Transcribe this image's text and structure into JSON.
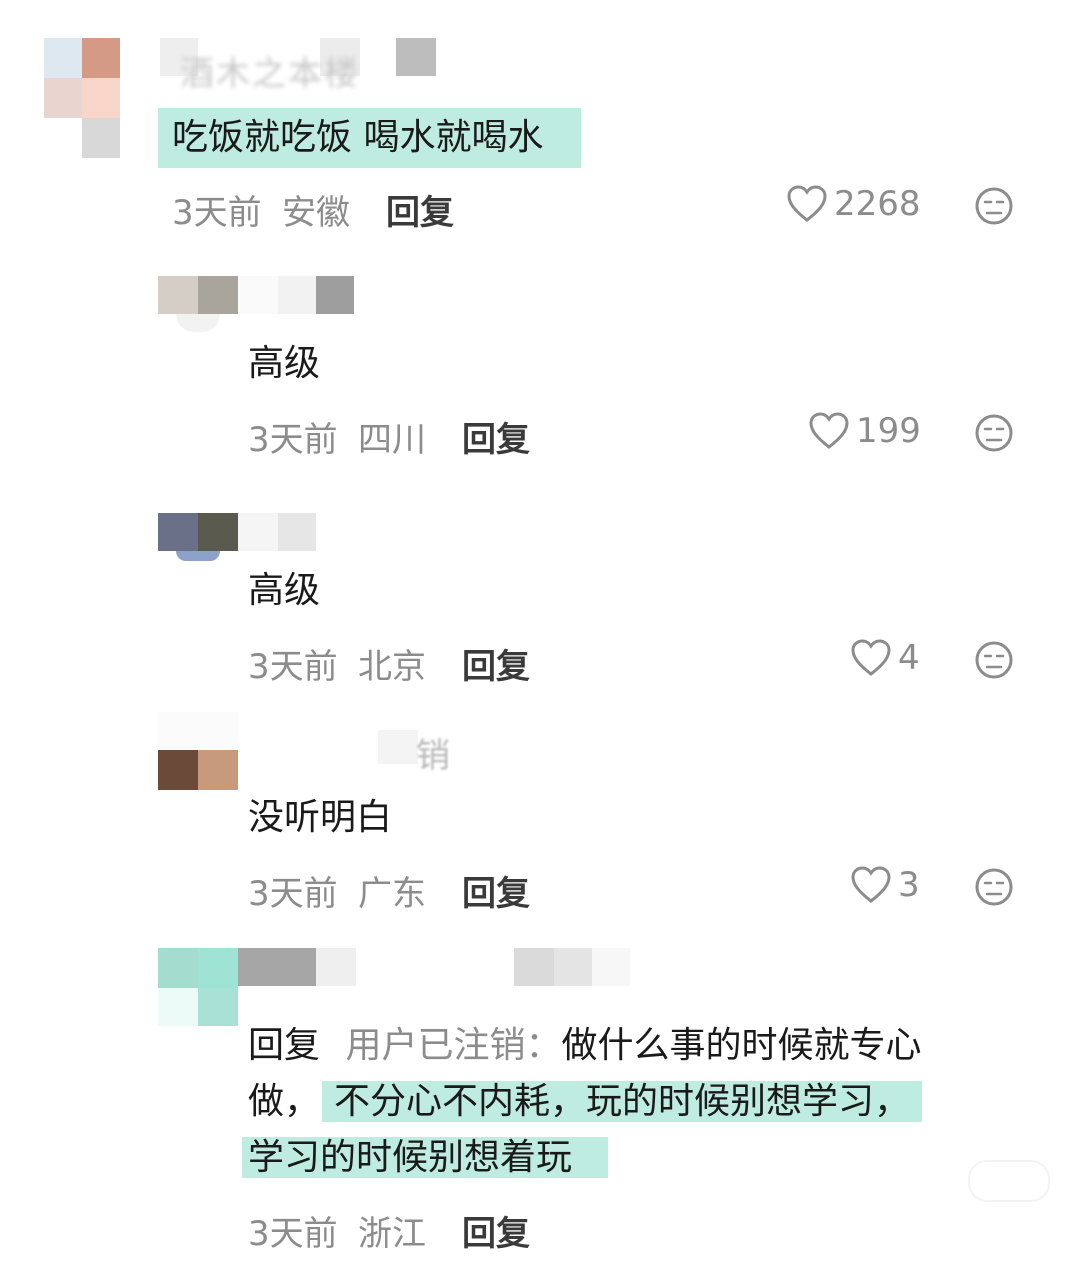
{
  "comments": [
    {
      "text": "吃饭就吃饭 喝水就喝水",
      "time": "3天前",
      "location": "安徽",
      "reply_label": "回复",
      "likes": "2268",
      "name_fragment": "酒木之本楼"
    },
    {
      "text": "高级",
      "time": "3天前",
      "location": "四川",
      "reply_label": "回复",
      "likes": "199"
    },
    {
      "text": "高级",
      "time": "3天前",
      "location": "北京",
      "reply_label": "回复",
      "likes": "4"
    },
    {
      "text": "没听明白",
      "time": "3天前",
      "location": "广东",
      "reply_label": "回复",
      "likes": "3",
      "name_fragment": "销"
    },
    {
      "reply_prefix": "回复",
      "reply_target": "用户已注销：",
      "text_line1_tail": "做什么事的时候就专心",
      "text_line2_plain": "做，",
      "text_line2_hl": "不分心不内耗，玩的时候别想学习，",
      "text_line3_hl": "学习的时候别想着玩",
      "time": "3天前",
      "location": "浙江",
      "reply_label": "回复"
    }
  ],
  "colors": {
    "highlight": "#bfece0",
    "meta": "#8c8c8c"
  },
  "icons": {
    "like": "heart-outline-icon",
    "dislike": "neutral-face-icon"
  }
}
